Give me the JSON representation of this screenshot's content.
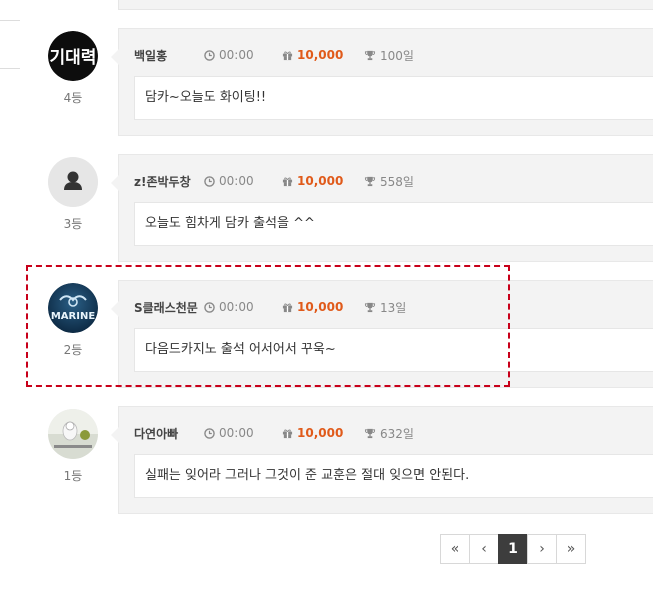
{
  "comments": [
    {
      "rank": "4등",
      "name": "백일홍",
      "time": "00:00",
      "points": "10,000",
      "days": "100일",
      "message": "담카~오늘도 화이팅!!",
      "avatar": "text-logo"
    },
    {
      "rank": "3등",
      "name": "z!존박두창",
      "time": "00:00",
      "points": "10,000",
      "days": "558일",
      "message": "오늘도 힘차게 담카 출석을 ^^",
      "avatar": "default-user"
    },
    {
      "rank": "2등",
      "name": "S클래스천문",
      "time": "00:00",
      "points": "10,000",
      "days": "13일",
      "message": "다음드카지노 출석 어서어서 꾸욱~",
      "avatar": "marine-logo"
    },
    {
      "rank": "1등",
      "name": "다연아빠",
      "time": "00:00",
      "points": "10,000",
      "days": "632일",
      "message": "실패는 잊어라 그러나 그것이 준 교훈은 절대 잊으면 안된다.",
      "avatar": "photo"
    }
  ],
  "avatar_texts": {
    "text_logo": "기대력",
    "marine": "MARINE"
  },
  "pagination": {
    "first": "«",
    "prev": "‹",
    "current": "1",
    "next": "›",
    "last": "»"
  },
  "colors": {
    "points": "#e05a1a",
    "highlight": "#c8001a",
    "active_page": "#3d3d3d"
  }
}
